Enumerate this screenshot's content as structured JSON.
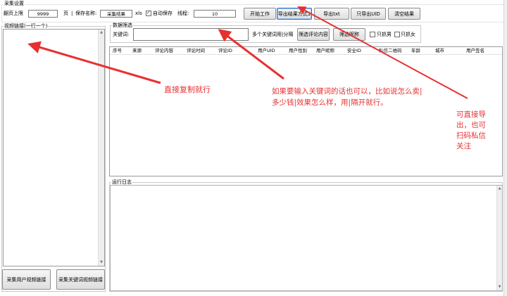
{
  "collect_settings": {
    "group_title": "采集设置",
    "page_limit_label": "翻页上限",
    "page_limit_value": "9999",
    "page_unit": "页",
    "separator": "|",
    "save_name_label": "保存名称:",
    "save_name_value": "采集结果",
    "save_ext": "xls",
    "autosave_label": "自动保存",
    "autosave_checked": true,
    "threads_label": "线程:",
    "threads_value": "10"
  },
  "toolbar": {
    "start_label": "开始工作",
    "export_mode_label": "导出结果方式1",
    "export_txt_label": "导出txt",
    "export_uid_label": "只导出UID",
    "clear_label": "清空结果"
  },
  "video_links": {
    "group_title": "视频链接(一行一个)",
    "btn_user_videos": "采集用户视频链接",
    "btn_keyword_videos": "采集关键词视频链接"
  },
  "filter": {
    "group_title": "数据筛选",
    "keyword_label": "关键词:",
    "keyword_value": "",
    "hint": "多个关键词用|分隔",
    "btn_filter_comments": "筛选评论内容",
    "btn_filter_nickname": "筛选昵称",
    "male_only_label": "只抓男",
    "female_only_label": "只抓女"
  },
  "table": {
    "columns": [
      "序号",
      "来源",
      "评论内容",
      "评论时间",
      "评论ID",
      "用户UID",
      "用户性别",
      "用户昵称",
      "安全ID",
      "私信二维码",
      "年龄",
      "城市",
      "用户签名"
    ]
  },
  "log": {
    "group_title": "运行日志"
  },
  "annotations": {
    "copy_hint": "直接复制就行",
    "keyword_hint_1": "如果要输入关键词的话也可以，比如说怎么卖|",
    "keyword_hint_2": "多少钱|效果怎么样，用|隔开就行。",
    "export_hint_1": "可直接导",
    "export_hint_2": "出，也可",
    "export_hint_3": "扫码私信",
    "export_hint_4": "关注",
    "color": "#e83030"
  }
}
